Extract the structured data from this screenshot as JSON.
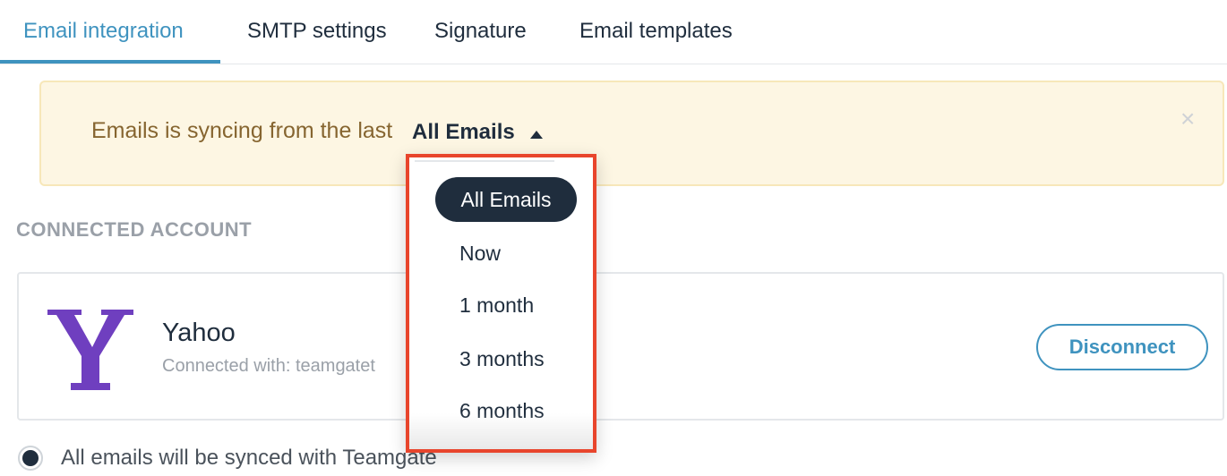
{
  "tabs": [
    {
      "label": "Email integration",
      "active": true
    },
    {
      "label": "SMTP settings",
      "active": false
    },
    {
      "label": "Signature",
      "active": false
    },
    {
      "label": "Email templates",
      "active": false
    }
  ],
  "banner": {
    "text": "Emails is syncing from the last",
    "selected_range": "All Emails",
    "close_symbol": "×"
  },
  "section": {
    "title": "CONNECTED ACCOUNT"
  },
  "account": {
    "provider": "Yahoo",
    "logo_letter": "Y",
    "connected_text": "Connected with: teamgatet",
    "disconnect_label": "Disconnect"
  },
  "sync_option": {
    "label": "All emails will be synced with Teamgate",
    "selected": true
  },
  "dropdown": {
    "options": [
      "All Emails",
      "Now",
      "1 month",
      "3 months",
      "6 months"
    ],
    "selected_index": 0
  },
  "colors": {
    "accent": "#3f93bf",
    "dark": "#1f2d3d",
    "banner_bg": "#fdf6e3",
    "banner_text": "#866530",
    "highlight": "#e8452c",
    "yahoo_purple": "#6f3fbf"
  }
}
